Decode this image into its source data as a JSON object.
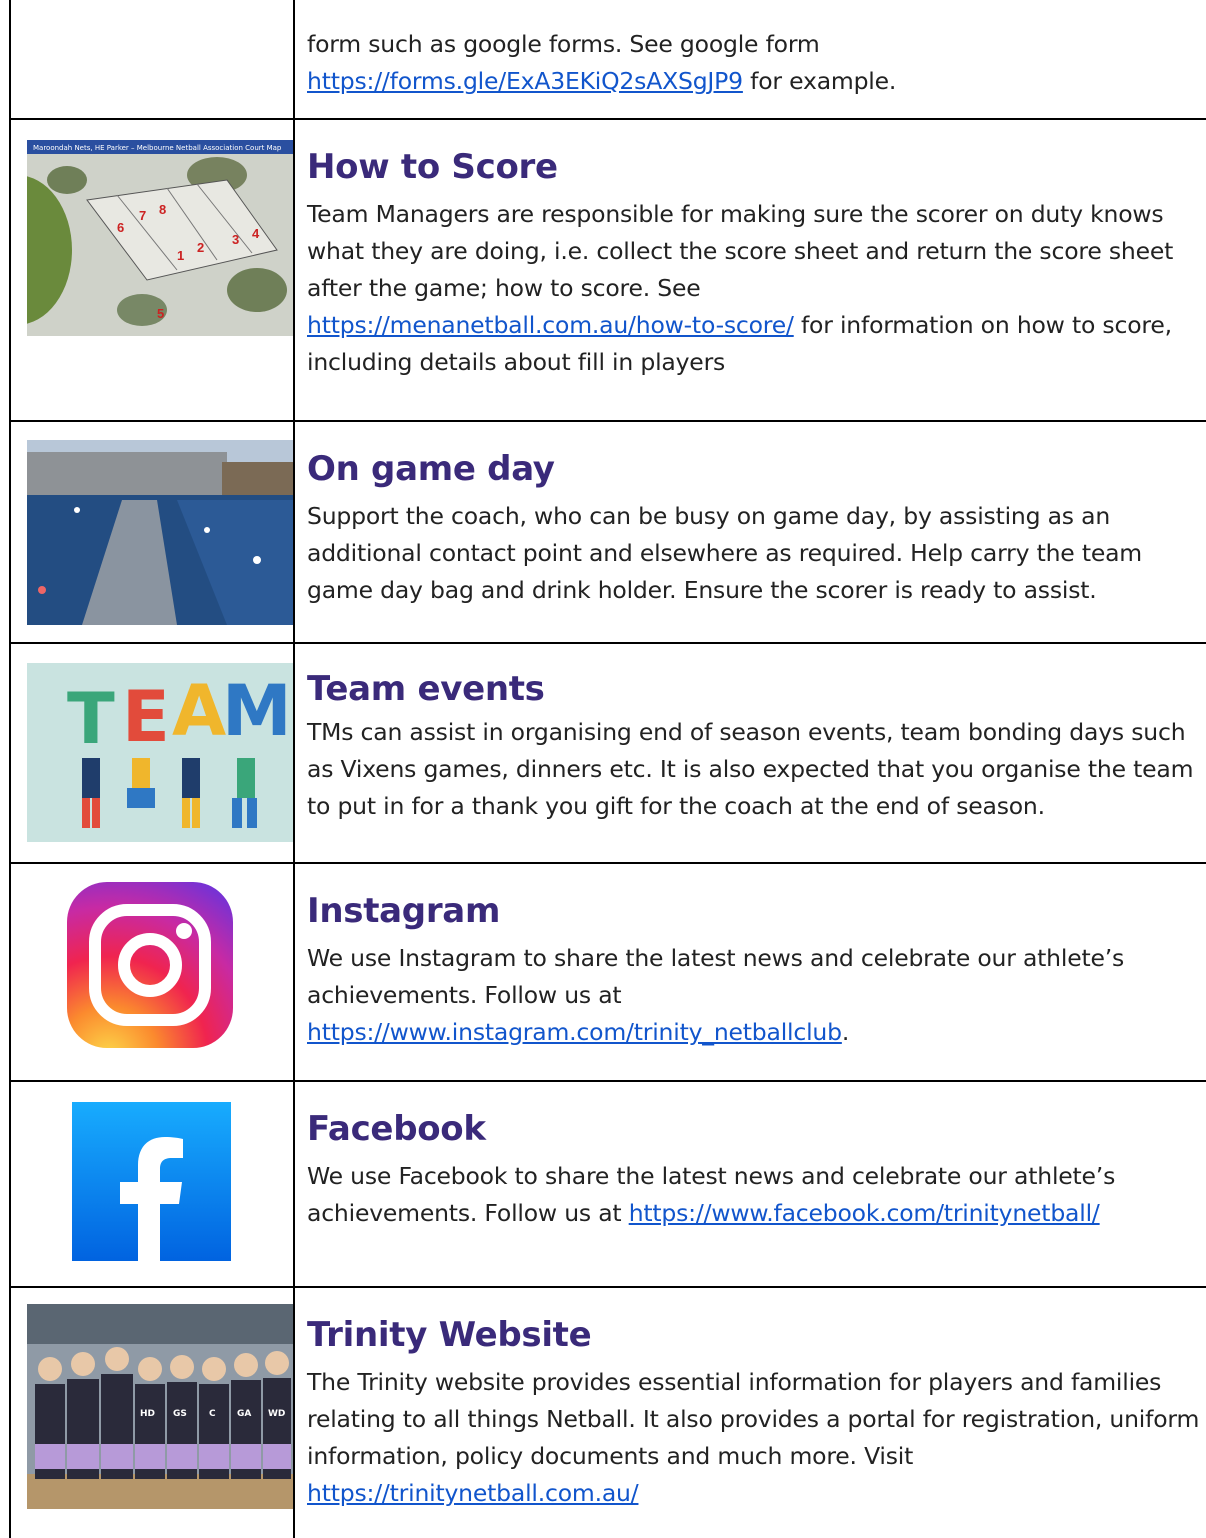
{
  "rows": [
    {
      "id": "intro",
      "text_before": "form such as google forms. See google form",
      "link": "https://forms.gle/ExA3EKiQ2sAXSgJP9",
      "text_after": " for example."
    },
    {
      "id": "how-to-score",
      "heading": "How to Score",
      "text_before": "Team Managers are responsible for making sure the scorer on duty knows what they are doing, i.e. collect the score sheet and return the score sheet after the game; how to score. See",
      "link": "https://menanetball.com.au/how-to-score/",
      "text_after": " for information on how to score, including details about fill in players",
      "image_caption": "Maroondah Nets, HE Parker – Melbourne Netball Association Court Map",
      "court_numbers": [
        "1",
        "2",
        "3",
        "4",
        "5",
        "6",
        "7",
        "8"
      ]
    },
    {
      "id": "game-day",
      "heading": "On game day",
      "text": "Support the coach, who  can be busy on game day, by assisting as an additional contact point and elsewhere as required. Help carry the team game day bag and drink holder. Ensure the scorer is ready to assist."
    },
    {
      "id": "team-events",
      "heading": "Team events",
      "text": "TMs can assist in organising end of season events, team bonding days such as Vixens games, dinners etc. It is also expected that you organise  the team to put in for a thank you gift for the coach at the end of season.",
      "image_letters": [
        "T",
        "E",
        "A",
        "M"
      ]
    },
    {
      "id": "instagram",
      "heading": "Instagram",
      "text_before": "We use Instagram to share the latest news and celebrate our athlete’s achievements. Follow us at",
      "link": "https://www.instagram.com/trinity_netballclub",
      "text_after": "."
    },
    {
      "id": "facebook",
      "heading": "Facebook",
      "text_before": "We use Facebook to share the latest news and celebrate our athlete’s achievements. Follow us at ",
      "link": "https://www.facebook.com/trinitynetball/",
      "text_after": ""
    },
    {
      "id": "website",
      "heading": "Trinity Website",
      "text_before": "The Trinity website provides essential information for players and families relating to all things Netball. It also provides a portal for registration, uniform information, policy documents and much more. Visit",
      "link": "https://trinitynetball.com.au/",
      "text_after": "",
      "bib_letters": [
        "HD",
        "GS",
        "C",
        "GA",
        "WD"
      ]
    }
  ],
  "colors": {
    "heading": "#3a2a7a",
    "link": "#1155cc",
    "facebook": "#1877f2"
  }
}
